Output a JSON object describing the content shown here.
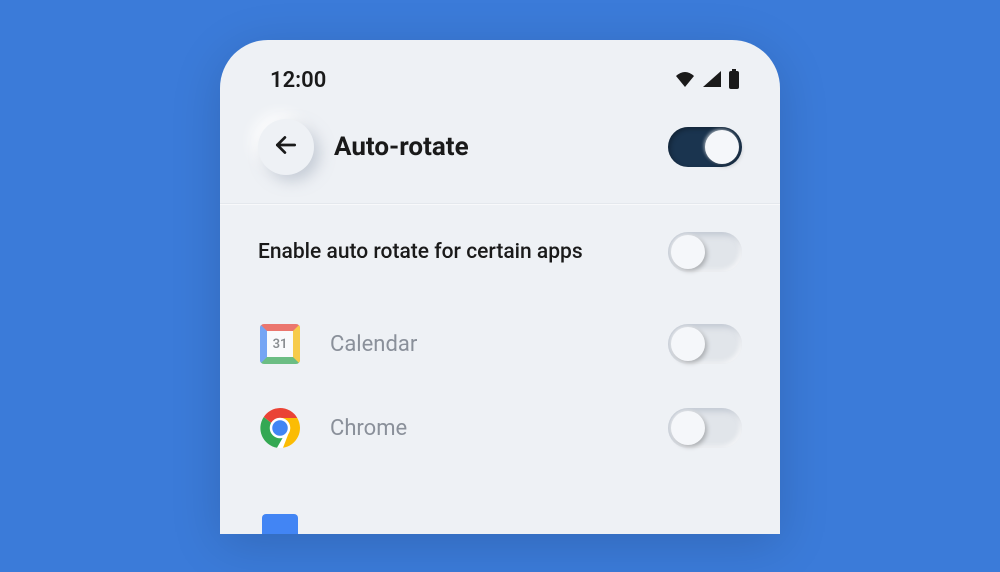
{
  "status": {
    "time": "12:00"
  },
  "header": {
    "title": "Auto-rotate",
    "main_toggle": true
  },
  "section": {
    "label": "Enable auto rotate for certain apps",
    "toggle": false
  },
  "apps": [
    {
      "icon": "calendar",
      "label": "Calendar",
      "day": "31",
      "toggle": false
    },
    {
      "icon": "chrome",
      "label": "Chrome",
      "toggle": false
    }
  ]
}
